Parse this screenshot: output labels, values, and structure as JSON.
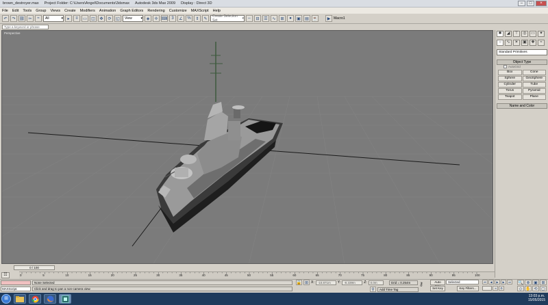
{
  "title": {
    "file": "brown_destroyer.max",
    "project": "Project Folder: C:\\Users\\Angel\\Documents\\3dsmax",
    "app": "Autodesk 3ds Max  2009",
    "display": "Display : Direct 3D"
  },
  "menu": [
    "File",
    "Edit",
    "Tools",
    "Group",
    "Views",
    "Create",
    "Modifiers",
    "Animation",
    "Graph Editors",
    "Rendering",
    "Customize",
    "MAXScript",
    "Help"
  ],
  "toolbar": {
    "selection_filter": "All",
    "ref_coord": "View",
    "named_selection_placeholder": "Create Selection Set",
    "macro_label": "Macro1"
  },
  "search": {
    "placeholder": "Type a keyword or phrase"
  },
  "viewport": {
    "label": "Perspective"
  },
  "command_panel": {
    "tabs": [
      {
        "icon": "create-icon"
      },
      {
        "icon": "modify-icon"
      },
      {
        "icon": "hierarchy-icon"
      },
      {
        "icon": "motion-icon"
      },
      {
        "icon": "display-icon"
      },
      {
        "icon": "utilities-icon"
      }
    ],
    "category_dropdown": "Standard Primitives",
    "object_type_title": "Object Type",
    "autogrid": "AutoGrid",
    "objects": [
      "Box",
      "Cone",
      "Sphere",
      "GeoSphere",
      "Cylinder",
      "Tube",
      "Torus",
      "Pyramid",
      "Teapot",
      "Plane"
    ],
    "name_color_title": "Name and Color"
  },
  "timeline": {
    "frame_slider": "0 / 100",
    "ticks": [
      "0",
      "5",
      "10",
      "15",
      "20",
      "25",
      "30",
      "35",
      "40",
      "45",
      "50",
      "55",
      "60",
      "65",
      "70",
      "75",
      "80",
      "85",
      "90",
      "95",
      "100"
    ]
  },
  "status": {
    "maxscript_label": "MAXScript.",
    "selection": "None Selected",
    "prompt": "Click and drag to pan a non-camera view",
    "x_label": "X:",
    "x_value": "-10.871m",
    "y_label": "Y:",
    "y_value": "-8.339m",
    "z_label": "Z:",
    "z_value": "0.0m",
    "grid": "Grid = 0.254m",
    "add_time_tag": "Add Time Tag",
    "auto_key": "Auto Key",
    "set_key": "Set Key",
    "key_dropdown": "Selected",
    "key_filters": "Key Filters..."
  },
  "taskbar": {
    "apps": [
      "windows-explorer-icon",
      "chrome-icon",
      "firefox-icon",
      "3dsmax-icon"
    ],
    "time": "13:03 p.m.",
    "date": "15/05/2015"
  }
}
